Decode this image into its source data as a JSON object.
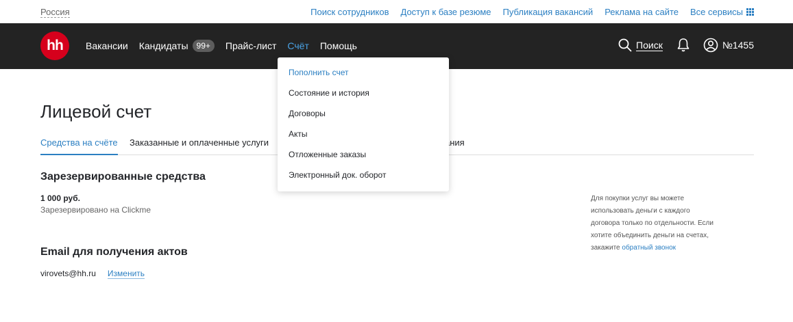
{
  "topbar": {
    "region": "Россия",
    "links": [
      "Поиск сотрудников",
      "Доступ к базе резюме",
      "Публикация вакансий",
      "Реклама на сайте",
      "Все сервисы"
    ]
  },
  "header": {
    "logo_text": "hh",
    "nav": {
      "vacancies": "Вакансии",
      "candidates": "Кандидаты",
      "candidates_badge": "99+",
      "pricelist": "Прайс-лист",
      "account": "Счёт",
      "help": "Помощь"
    },
    "search_label": "Поиск",
    "account_label": "№1455"
  },
  "dropdown": {
    "items": [
      "Пополнить счет",
      "Состояние и история",
      "Договоры",
      "Акты",
      "Отложенные заказы",
      "Электронный док. оборот"
    ]
  },
  "main": {
    "title": "Лицевой счет",
    "tabs": [
      "Средства на счёте",
      "Заказанные и оплаченные услуги",
      "ания"
    ],
    "reserved": {
      "title": "Зарезервированные средства",
      "amount": "1 000 руб.",
      "description": "Зарезервировано на Clickme"
    },
    "email_section": {
      "title": "Email для получения актов",
      "email": "virovets@hh.ru",
      "change_label": "Изменить"
    },
    "side_note": {
      "text": "Для покупки услуг вы можете использовать деньги с каждого договора только по отдельности. Если хотите объединить деньги на счетах, закажите ",
      "link": "обратный звонок"
    }
  },
  "colors": {
    "header_bg": "#232323",
    "accent": "#2b7fc2",
    "logo_bg": "#d6001c"
  }
}
